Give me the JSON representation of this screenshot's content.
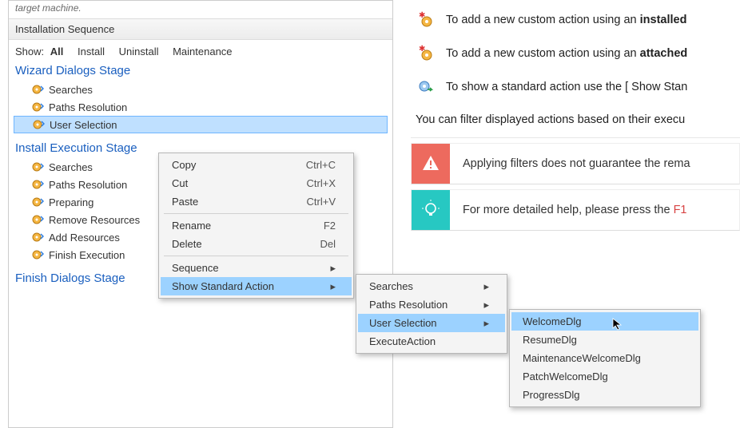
{
  "hint": "target machine.",
  "section_header": "Installation Sequence",
  "filter": {
    "label": "Show:",
    "options": [
      "All",
      "Install",
      "Uninstall",
      "Maintenance"
    ],
    "active": "All"
  },
  "stages": {
    "wizard": {
      "title": "Wizard Dialogs Stage",
      "items": [
        "Searches",
        "Paths Resolution",
        "User Selection"
      ],
      "selected": "User Selection"
    },
    "install": {
      "title": "Install Execution Stage",
      "items": [
        "Searches",
        "Paths Resolution",
        "Preparing",
        "Remove Resources",
        "Add Resources",
        "Finish Execution"
      ]
    },
    "finish": {
      "title": "Finish Dialogs Stage"
    }
  },
  "help": {
    "line1_pre": "To add a new custom action using an ",
    "line1_bold": "installed",
    "line2_pre": "To add a new custom action using an ",
    "line2_bold": "attached",
    "line3": "To show a standard action use the [ Show Stan",
    "filter_text": "You can filter displayed actions based on their execu",
    "warn": "Applying filters does not guarantee the rema",
    "info_pre": "For more detailed help, please press the ",
    "info_key": "F1 "
  },
  "context_menu": {
    "copy": "Copy",
    "copy_k": "Ctrl+C",
    "cut": "Cut",
    "cut_k": "Ctrl+X",
    "paste": "Paste",
    "paste_k": "Ctrl+V",
    "rename": "Rename",
    "rename_k": "F2",
    "delete": "Delete",
    "delete_k": "Del",
    "sequence": "Sequence",
    "show_std": "Show Standard Action"
  },
  "submenu1": {
    "searches": "Searches",
    "paths": "Paths Resolution",
    "user_sel": "User Selection",
    "exec": "ExecuteAction"
  },
  "submenu2": {
    "welcome": "WelcomeDlg",
    "resume": "ResumeDlg",
    "maint": "MaintenanceWelcomeDlg",
    "patch": "PatchWelcomeDlg",
    "progress": "ProgressDlg"
  }
}
